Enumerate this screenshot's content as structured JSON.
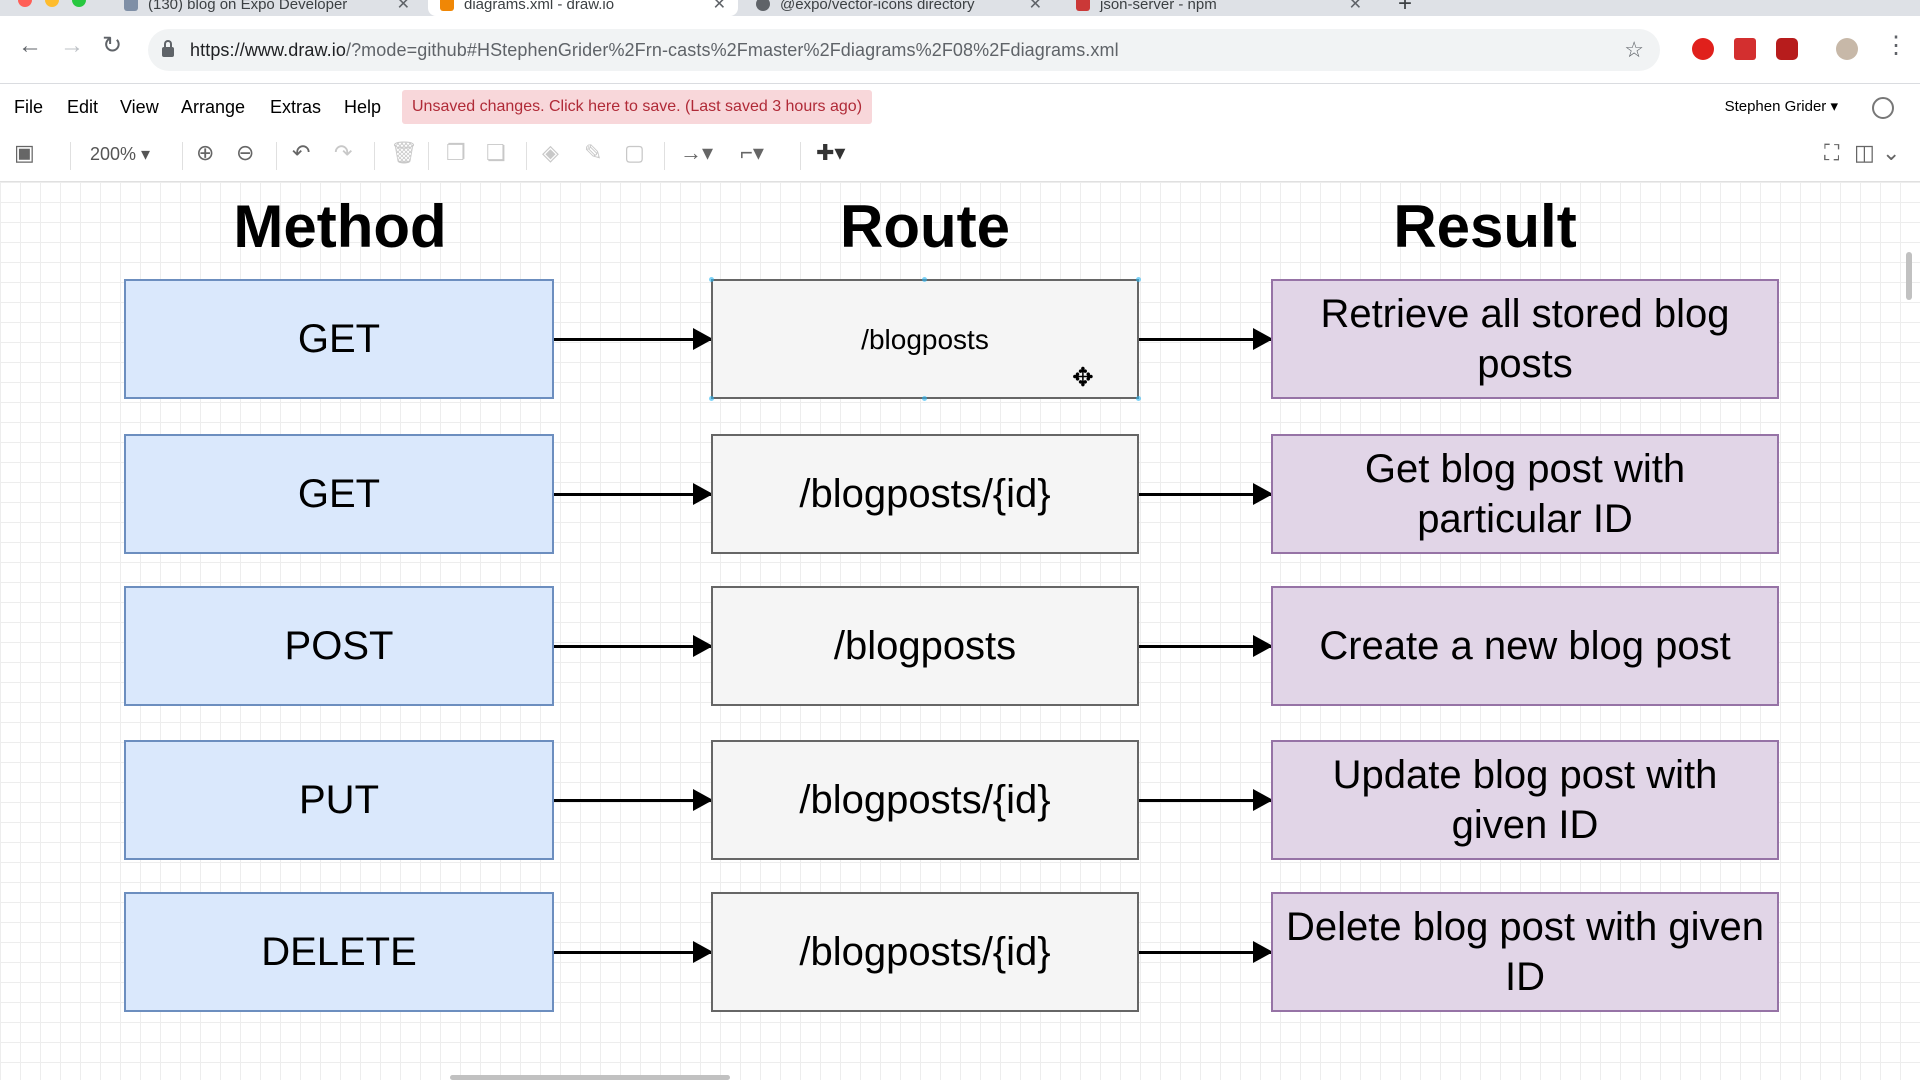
{
  "browser": {
    "tabs": [
      {
        "title": "(130) blog on Expo Developer",
        "favicon_color": "#7f8fa6"
      },
      {
        "title": "diagrams.xml - draw.io",
        "favicon_color": "#f08705"
      },
      {
        "title": "@expo/vector-icons directory",
        "favicon_color": "#5f6368"
      },
      {
        "title": "json-server - npm",
        "favicon_color": "#cb3837"
      }
    ],
    "close_glyph": "✕",
    "new_tab_glyph": "+",
    "url_host": "https://www.draw.io",
    "url_rest": "/?mode=github#HStephenGrider%2Frn-casts%2Fmaster%2Fdiagrams%2F08%2Fdiagrams.xml"
  },
  "menubar": {
    "items": [
      "File",
      "Edit",
      "View",
      "Arrange",
      "Extras",
      "Help"
    ],
    "unsaved_notice": "Unsaved changes. Click here to save. (Last saved 3 hours ago)",
    "user": "Stephen Grider ▾"
  },
  "toolbar": {
    "zoom": "200% ▾"
  },
  "diagram": {
    "headers": {
      "method": "Method",
      "route": "Route",
      "result": "Result"
    },
    "rows": [
      {
        "method": "GET",
        "route": "/blogposts",
        "result": "Retrieve all stored blog posts"
      },
      {
        "method": "GET",
        "route": "/blogposts/{id}",
        "result": "Get blog post with particular ID"
      },
      {
        "method": "POST",
        "route": "/blogposts",
        "result": "Create a new blog post"
      },
      {
        "method": "PUT",
        "route": "/blogposts/{id}",
        "result": "Update blog post with given ID"
      },
      {
        "method": "DELETE",
        "route": "/blogposts/{id}",
        "result": "Delete blog post with given ID"
      }
    ],
    "colors": {
      "method_fill": "#dae8fc",
      "method_stroke": "#6c8ebf",
      "route_fill": "#f5f5f5",
      "route_stroke": "#666666",
      "result_fill": "#e1d5e7",
      "result_stroke": "#9673a6"
    }
  }
}
